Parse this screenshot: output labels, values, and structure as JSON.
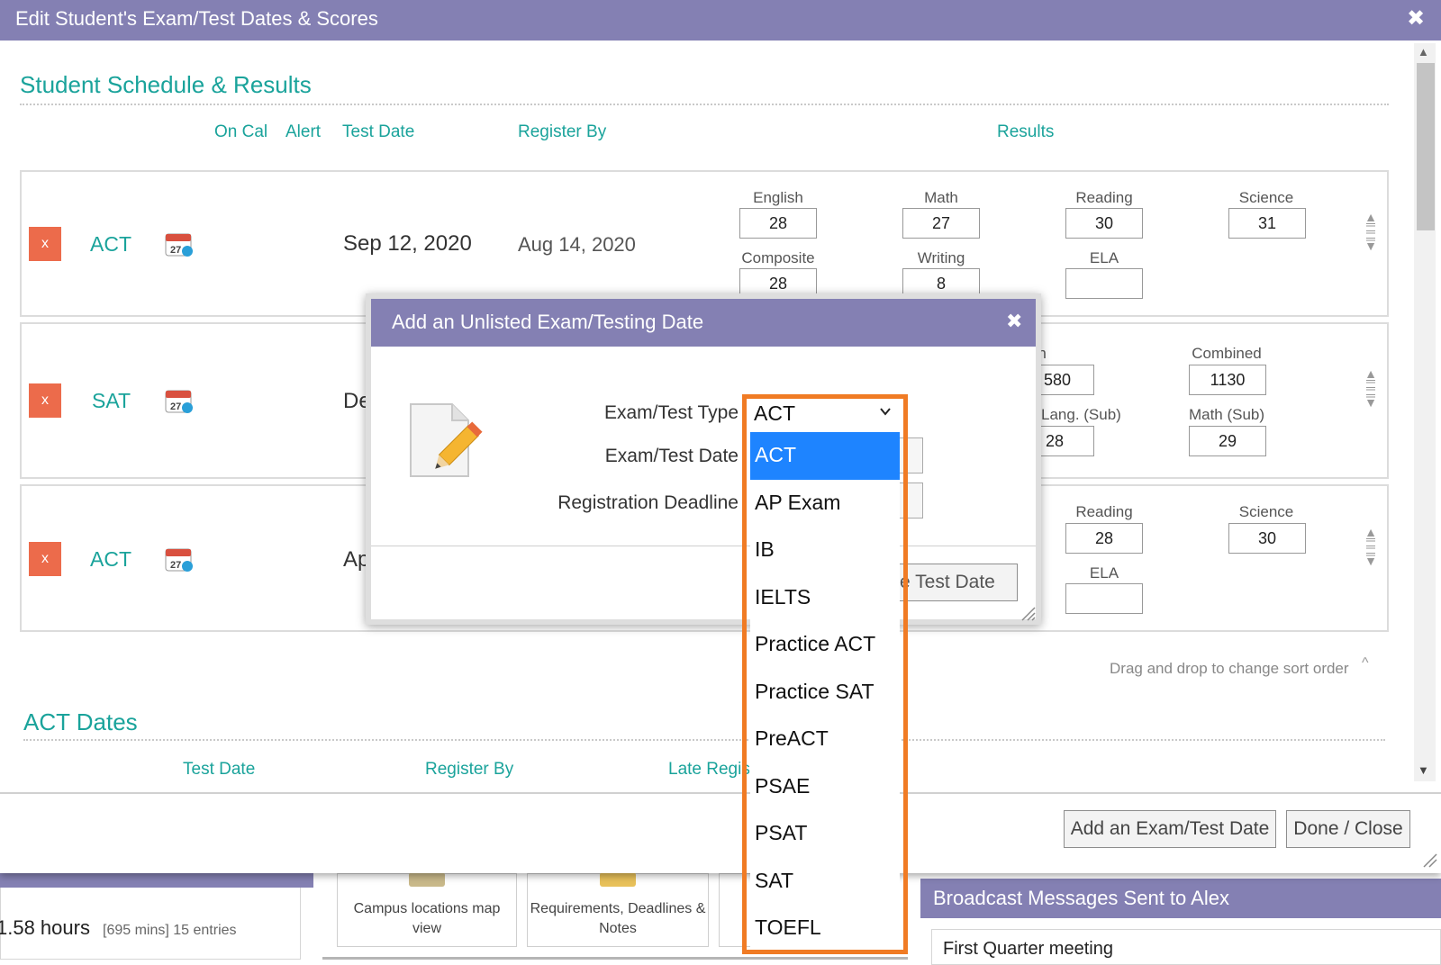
{
  "dialog": {
    "title": "Edit Student's Exam/Test Dates & Scores",
    "close_glyph": "✖"
  },
  "schedule": {
    "section_title": "Student Schedule & Results",
    "columns": {
      "on_cal": "On Cal",
      "alert": "Alert",
      "test_date": "Test Date",
      "register_by": "Register By",
      "results": "Results"
    },
    "rows": [
      {
        "delete_label": "x",
        "exam": "ACT",
        "test_date": "Sep 12, 2020",
        "register_by": "Aug 14, 2020",
        "scores": [
          {
            "label": "English",
            "value": "28"
          },
          {
            "label": "Math",
            "value": "27"
          },
          {
            "label": "Reading",
            "value": "30"
          },
          {
            "label": "Science",
            "value": "31"
          },
          {
            "label": "Composite",
            "value": "28"
          },
          {
            "label": "Writing",
            "value": "8"
          },
          {
            "label": "ELA",
            "value": ""
          }
        ]
      },
      {
        "delete_label": "x",
        "exam": "SAT",
        "test_date": "De",
        "scores": [
          {
            "label": "Math",
            "value": "580"
          },
          {
            "label": "Combined",
            "value": "1130"
          },
          {
            "label": "Lang. (Sub)",
            "value": "28"
          },
          {
            "label": "Math (Sub)",
            "value": "29"
          }
        ]
      },
      {
        "delete_label": "x",
        "exam": "ACT",
        "test_date": "Ap",
        "scores": [
          {
            "label": "Reading",
            "value": "28"
          },
          {
            "label": "Science",
            "value": "30"
          },
          {
            "label": "ELA",
            "value": ""
          }
        ]
      }
    ],
    "sort_hint": "Drag and drop to change sort order",
    "sort_caret": "^"
  },
  "act_dates": {
    "section_title": "ACT Dates",
    "columns": {
      "test_date": "Test Date",
      "register_by": "Register By",
      "late_registration": "Late Regis"
    }
  },
  "footer": {
    "add_button": "Add an Exam/Test Date",
    "done_button": "Done / Close"
  },
  "modal": {
    "title": "Add an Unlisted Exam/Testing Date",
    "close_glyph": "✖",
    "labels": {
      "type": "Exam/Test Type",
      "date": "Exam/Test Date",
      "deadline": "Registration Deadline"
    },
    "save_button_visible": "e Test Date",
    "select": {
      "value": "ACT",
      "options": [
        "ACT",
        "AP Exam",
        "IB",
        "IELTS",
        "Practice ACT",
        "Practice SAT",
        "PreACT",
        "PSAE",
        "PSAT",
        "SAT",
        "TOEFL"
      ],
      "selected_index": 0
    }
  },
  "background": {
    "hours": "1.58 hours",
    "hours_detail": "[695 mins] 15 entries",
    "tiles": [
      "Campus locations map view",
      "Requirements, Deadlines & Notes"
    ],
    "broadcast_title": "Broadcast Messages Sent to Alex",
    "broadcast_first": "First Quarter meeting"
  },
  "colors": {
    "title_bar": "#8480b3",
    "accent_teal": "#1aa39b",
    "delete_red": "#ec6b4b",
    "selection_blue": "#1e84ff",
    "highlight_orange": "#f07b24"
  }
}
